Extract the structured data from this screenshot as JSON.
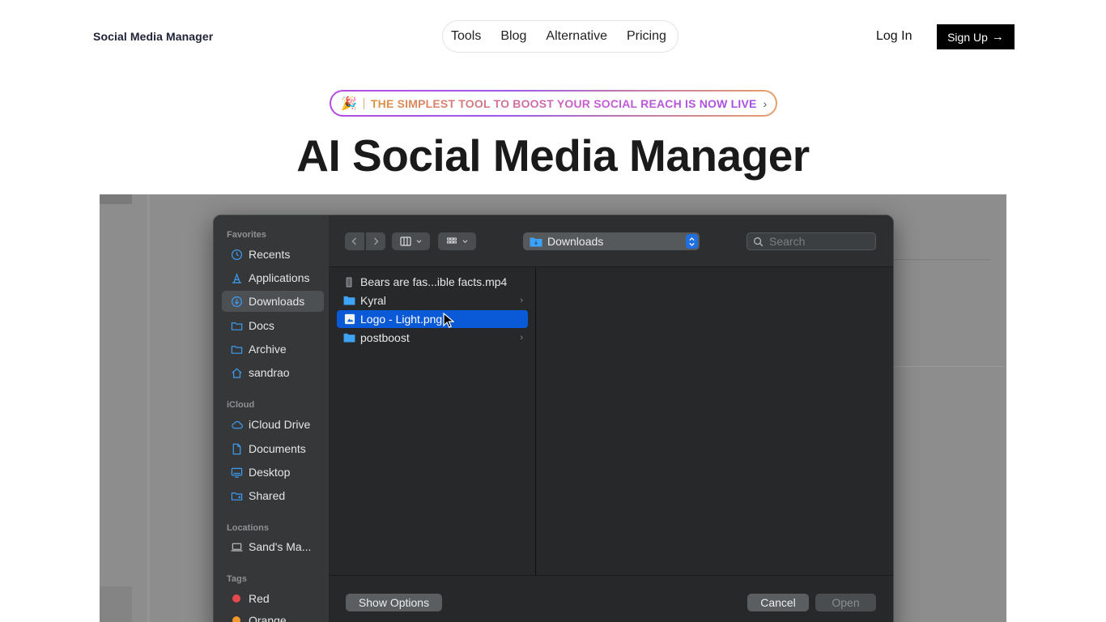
{
  "site": {
    "brand": "Social Media Manager",
    "nav": [
      "Tools",
      "Blog",
      "Alternative",
      "Pricing"
    ],
    "login": "Log In",
    "signup": "Sign Up",
    "announcement": "THE SIMPLEST TOOL TO BOOST YOUR SOCIAL REACH IS NOW LIVE",
    "announcement_emoji": "🎉",
    "hero_title": "AI Social Media Manager"
  },
  "dialog": {
    "sidebar": {
      "favorites_label": "Favorites",
      "favorites": [
        "Recents",
        "Applications",
        "Downloads",
        "Docs",
        "Archive",
        "sandrao"
      ],
      "active_item": "Downloads",
      "icloud_label": "iCloud",
      "icloud": [
        "iCloud Drive",
        "Documents",
        "Desktop",
        "Shared"
      ],
      "locations_label": "Locations",
      "locations": [
        "Sand's Ma..."
      ],
      "tags_label": "Tags",
      "tags": [
        {
          "name": "Red",
          "color": "#e5484d"
        },
        {
          "name": "Orange",
          "color": "#f29a2e"
        }
      ]
    },
    "toolbar": {
      "location": "Downloads",
      "search_placeholder": "Search"
    },
    "files": [
      {
        "name": "Bears are fas...ible facts.mp4",
        "type": "video",
        "has_children": false,
        "selected": false
      },
      {
        "name": "Kyral",
        "type": "folder",
        "has_children": true,
        "selected": false
      },
      {
        "name": "Logo - Light.png",
        "type": "image",
        "has_children": false,
        "selected": true
      },
      {
        "name": "postboost",
        "type": "folder",
        "has_children": true,
        "selected": false
      }
    ],
    "buttons": {
      "show_options": "Show Options",
      "cancel": "Cancel",
      "open": "Open"
    }
  },
  "colors": {
    "selection": "#0a5ad8",
    "sidebar_icon": "#3d9bf0",
    "signup_bg": "#000000"
  }
}
